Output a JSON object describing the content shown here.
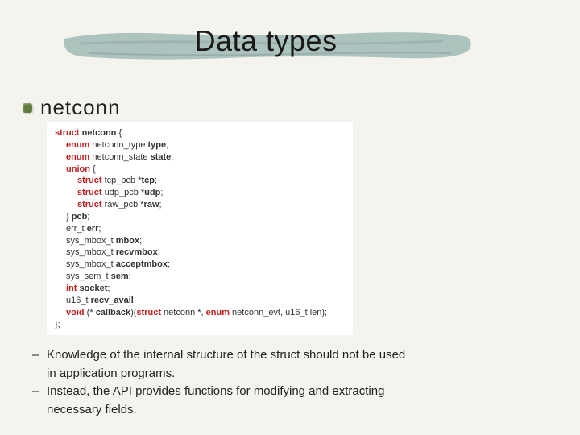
{
  "title": "Data types",
  "subtitle": "netconn",
  "code": {
    "struct_kw": "struct",
    "struct_name": "netconn",
    "obrace": " {",
    "enum_kw": "enum",
    "type_line_a": " netconn_type ",
    "type_line_b": "type",
    "semicolon": ";",
    "state_line_a": " netconn_state ",
    "state_line_b": "state",
    "union_kw": "union",
    "tcp_a": " tcp_pcb *",
    "tcp_b": "tcp",
    "udp_a": " udp_pcb *",
    "udp_b": "udp",
    "raw_a": " raw_pcb *",
    "raw_b": "raw",
    "pcb_close": "} ",
    "pcb_name": "pcb",
    "err_a": "err_t ",
    "err_b": "err",
    "mbox_a": "sys_mbox_t ",
    "mbox_b": "mbox",
    "recv_a": "sys_mbox_t ",
    "recv_b": "recvmbox",
    "accept_a": "sys_mbox_t ",
    "accept_b": "acceptmbox",
    "sem_a": "sys_sem_t ",
    "sem_b": "sem",
    "int_kw": "int",
    "sock_a": " ",
    "sock_b": "socket",
    "u16_a": "u16_t ",
    "u16_b": "recv_avail",
    "void_kw": "void",
    "cb_a": " (* ",
    "cb_b": "callback",
    "cb_c": ")(",
    "cb_d": " netconn *, ",
    "cb_e": " netconn_evt, u16_t len);",
    "close": "};"
  },
  "notes": {
    "n1a": "Knowledge of the internal structure of the struct should not be used",
    "n1b": "in application programs.",
    "n2a": "Instead, the API provides functions for modifying and extracting",
    "n2b": "necessary fields."
  }
}
